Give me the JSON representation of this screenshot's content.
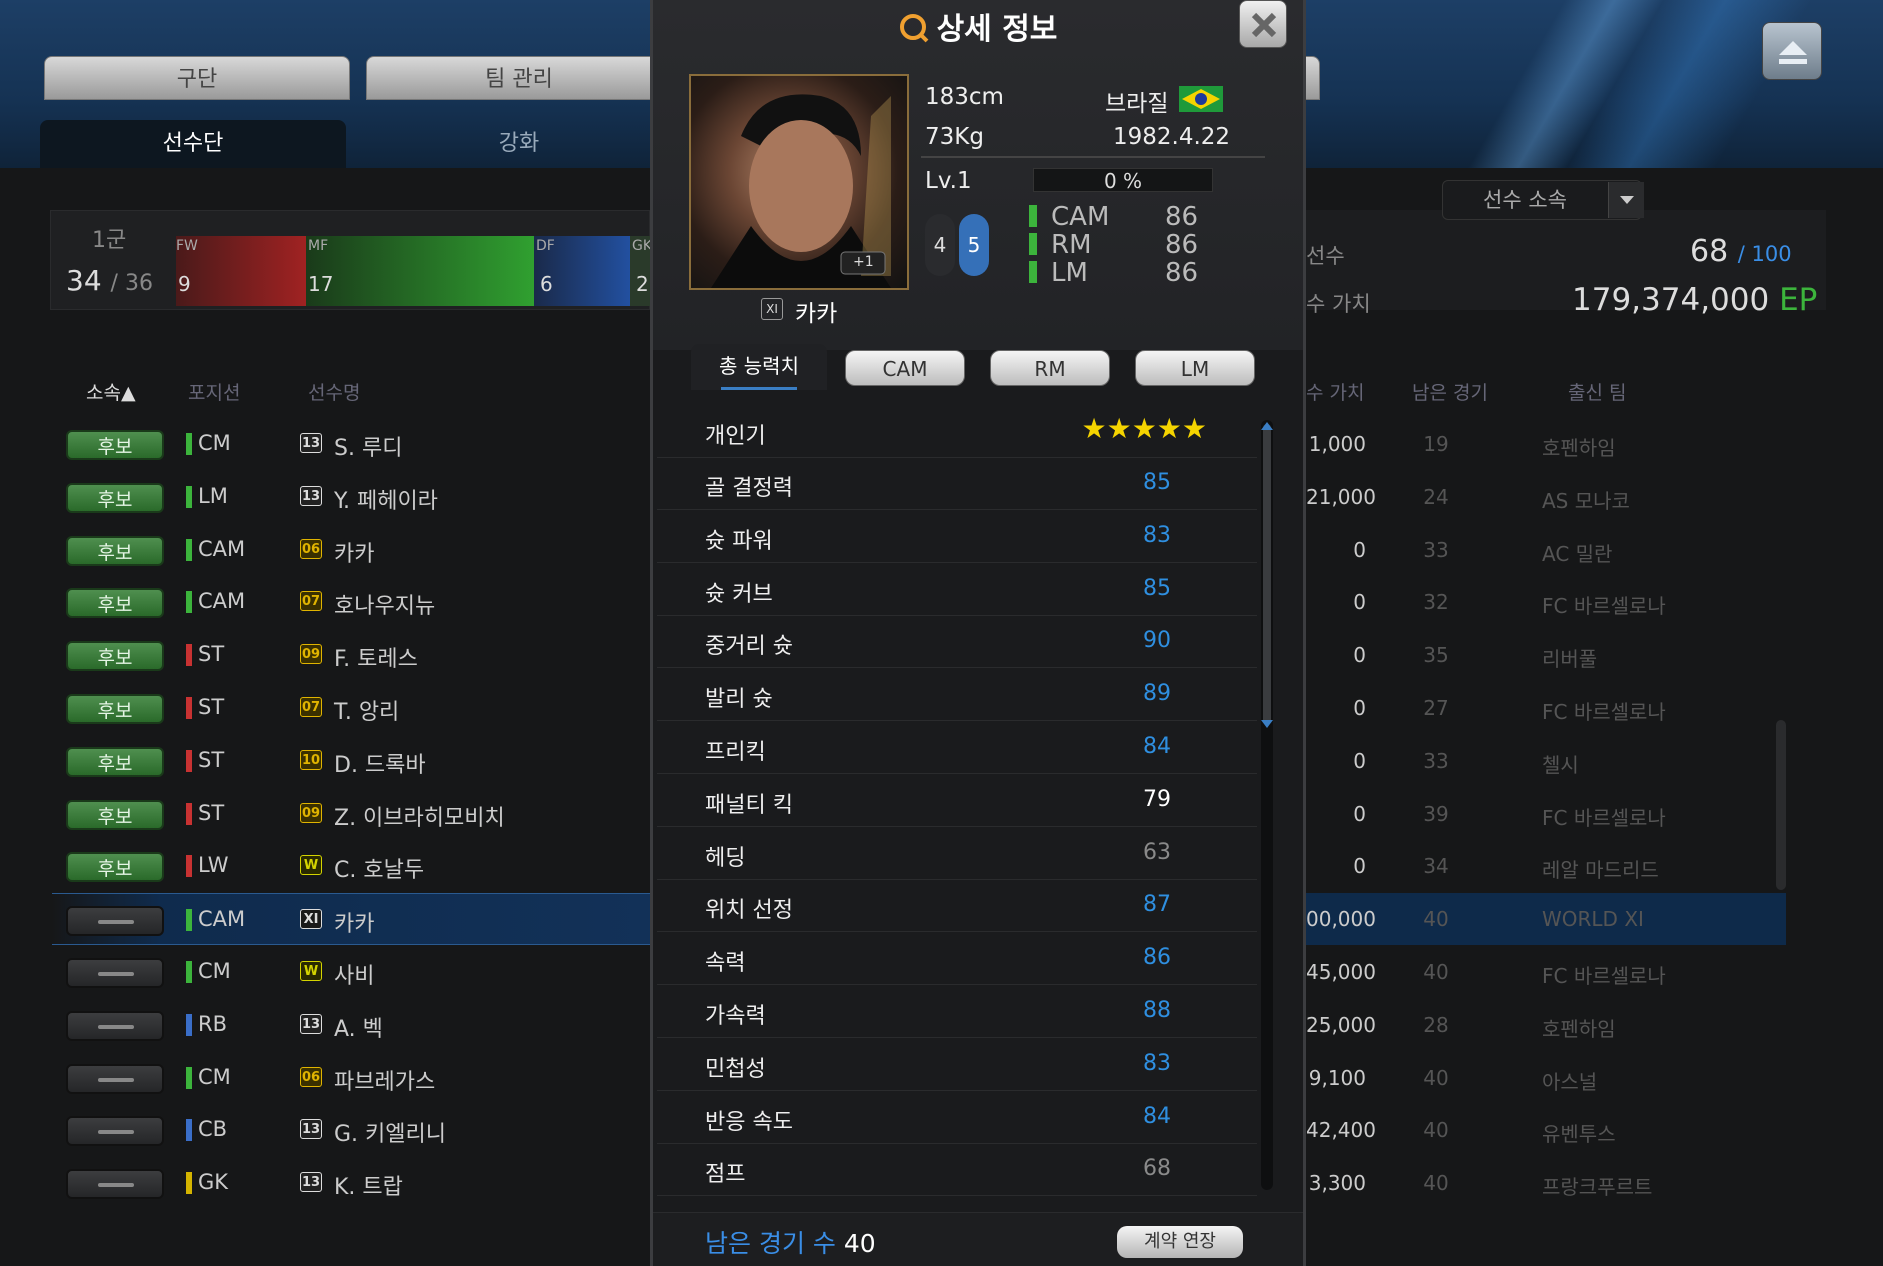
{
  "top_tabs": [
    "구단",
    "팀 관리"
  ],
  "sub_tabs": [
    "선수단",
    "강화"
  ],
  "squad": {
    "label": "1군",
    "count": "34",
    "max": "/ 36",
    "positions": [
      {
        "label": "FW",
        "num": "9"
      },
      {
        "label": "MF",
        "num": "17"
      },
      {
        "label": "DF",
        "num": "6"
      },
      {
        "label": "GK",
        "num": "2"
      }
    ]
  },
  "columns": {
    "affiliation": "소속▲",
    "position": "포지션",
    "player": "선수명",
    "value": "수 가치",
    "games": "남은 경기",
    "team": "출신 팀"
  },
  "players": [
    {
      "badge": "후보",
      "pos": "CM",
      "season": "13",
      "name": "S. 루디",
      "value": "1,000",
      "games": "19",
      "team": "호펜하임"
    },
    {
      "badge": "후보",
      "pos": "LM",
      "season": "13",
      "name": "Y. 페헤이라",
      "value": "21,000",
      "games": "24",
      "team": "AS 모나코"
    },
    {
      "badge": "후보",
      "pos": "CAM",
      "season": "06",
      "name": "카카",
      "value": "0",
      "games": "33",
      "team": "AC 밀란"
    },
    {
      "badge": "후보",
      "pos": "CAM",
      "season": "07",
      "name": "호나우지뉴",
      "value": "0",
      "games": "32",
      "team": "FC 바르셀로나"
    },
    {
      "badge": "후보",
      "pos": "ST",
      "season": "09",
      "name": "F. 토레스",
      "value": "0",
      "games": "35",
      "team": "리버풀"
    },
    {
      "badge": "후보",
      "pos": "ST",
      "season": "07",
      "name": "T. 앙리",
      "value": "0",
      "games": "27",
      "team": "FC 바르셀로나"
    },
    {
      "badge": "후보",
      "pos": "ST",
      "season": "10",
      "name": "D. 드록바",
      "value": "0",
      "games": "33",
      "team": "첼시"
    },
    {
      "badge": "후보",
      "pos": "ST",
      "season": "09",
      "name": "Z. 이브라히모비치",
      "value": "0",
      "games": "39",
      "team": "FC 바르셀로나"
    },
    {
      "badge": "후보",
      "pos": "LW",
      "season": "W",
      "name": "C. 호날두",
      "value": "0",
      "games": "34",
      "team": "레알 마드리드"
    },
    {
      "badge": "",
      "pos": "CAM",
      "season": "XI",
      "name": "카카",
      "value": "00,000",
      "games": "40",
      "team": "WORLD XI"
    },
    {
      "badge": "",
      "pos": "CM",
      "season": "W",
      "name": "사비",
      "value": "45,000",
      "games": "40",
      "team": "FC 바르셀로나"
    },
    {
      "badge": "",
      "pos": "RB",
      "season": "13",
      "name": "A. 벡",
      "value": "25,000",
      "games": "28",
      "team": "호펜하임"
    },
    {
      "badge": "",
      "pos": "CM",
      "season": "06",
      "name": "파브레가스",
      "value": "9,100",
      "games": "40",
      "team": "아스널"
    },
    {
      "badge": "",
      "pos": "CB",
      "season": "13",
      "name": "G. 키엘리니",
      "value": "42,400",
      "games": "40",
      "team": "유벤투스"
    },
    {
      "badge": "",
      "pos": "GK",
      "season": "13",
      "name": "K. 트랍",
      "value": "3,300",
      "games": "40",
      "team": "프랑크푸르트"
    }
  ],
  "right_panel": {
    "dropdown": "선수 소속",
    "label1": "선수",
    "players_count": "68",
    "players_max": "/ 100",
    "label2": "수 가치",
    "value": "179,374,000",
    "value_unit": "EP"
  },
  "modal": {
    "title": "상세 정보",
    "height": "183cm",
    "weight": "73Kg",
    "country": "브라질",
    "birth": "1982.4.22",
    "level": "Lv.1",
    "exp": "0 %",
    "skill": "4",
    "weak": "5",
    "plus": "+1",
    "positions": [
      {
        "name": "CAM",
        "ovr": "86"
      },
      {
        "name": "RM",
        "ovr": "86"
      },
      {
        "name": "LM",
        "ovr": "86"
      }
    ],
    "season": "XI",
    "player_name": "카카",
    "tabs": [
      "총 능력치",
      "CAM",
      "RM",
      "LM"
    ],
    "popularity_label": "개인기",
    "stars": "★★★★★",
    "stats": [
      {
        "name": "골 결정력",
        "value": "85"
      },
      {
        "name": "슛 파워",
        "value": "83"
      },
      {
        "name": "슛 커브",
        "value": "85"
      },
      {
        "name": "중거리 슛",
        "value": "90"
      },
      {
        "name": "발리 슛",
        "value": "89"
      },
      {
        "name": "프리킥",
        "value": "84"
      },
      {
        "name": "패널티 킥",
        "value": "79"
      },
      {
        "name": "헤딩",
        "value": "63"
      },
      {
        "name": "위치 선정",
        "value": "87"
      },
      {
        "name": "속력",
        "value": "86"
      },
      {
        "name": "가속력",
        "value": "88"
      },
      {
        "name": "민첩성",
        "value": "83"
      },
      {
        "name": "반응 속도",
        "value": "84"
      },
      {
        "name": "점프",
        "value": "68"
      }
    ],
    "games_left_label": "남은 경기 수",
    "games_left": "40",
    "renew": "계약 연장"
  },
  "colors": {
    "accent": "#3a8ee6",
    "green": "#2f7d2f",
    "high": "#2f8fe0",
    "mid": "#ffffff",
    "low": "#8a8a8a"
  }
}
